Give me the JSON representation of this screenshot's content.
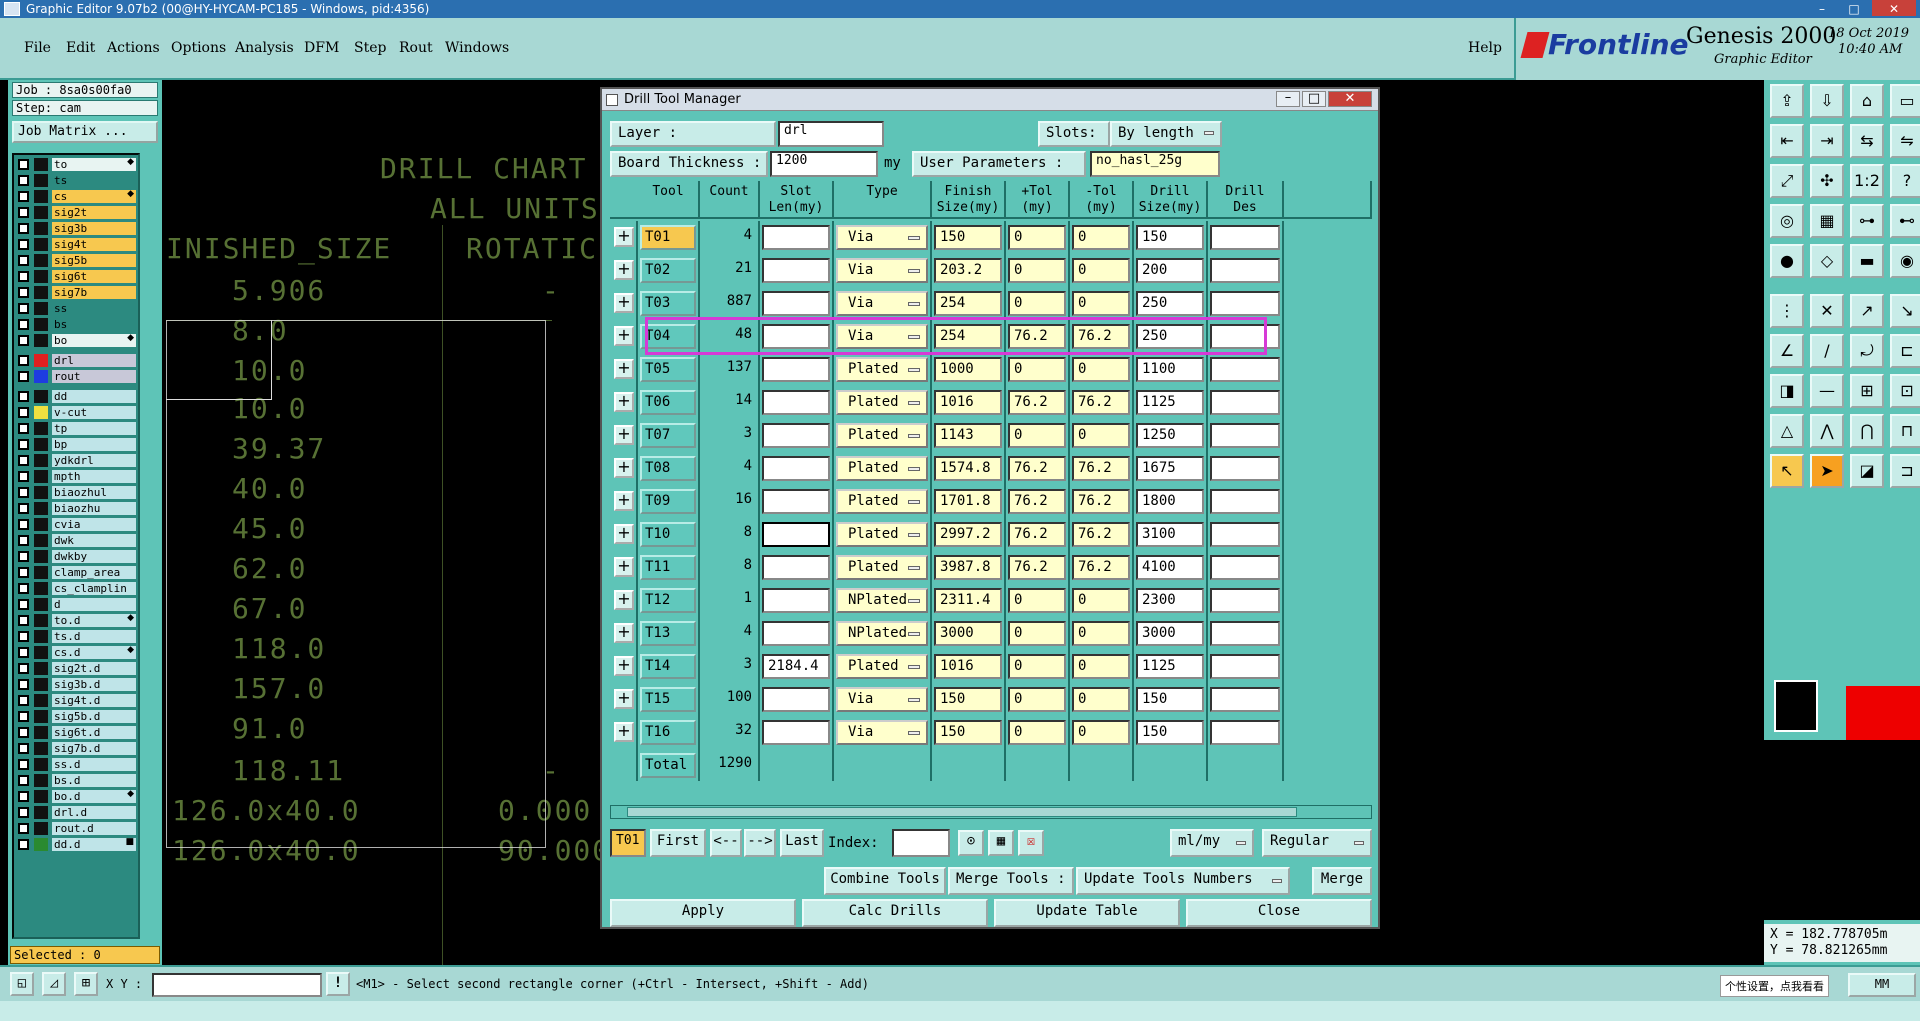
{
  "window_title": "Graphic Editor 9.07b2 (00@HY-HYCAM-PC185 - Windows, pid:4356)",
  "menu": [
    "File",
    "Edit",
    "Actions",
    "Options",
    "Analysis",
    "DFM",
    "Step",
    "Rout",
    "Windows"
  ],
  "help": "Help",
  "logo": {
    "brand": "Frontline",
    "product": "Genesis 2000",
    "subtitle": "Graphic Editor",
    "date": "18 Oct 2019",
    "time": "10:40 AM"
  },
  "job_info": {
    "job": "Job : 8sa0s00fa0",
    "step": "Step: cam",
    "matrix_button": "Job Matrix ..."
  },
  "layers": [
    {
      "name": "to",
      "color": "#e8f4f2",
      "sw": "#111",
      "arrow": "◆"
    },
    {
      "name": "ts",
      "color": "#2c8a80",
      "sw": "#111",
      "arrow": ""
    },
    {
      "name": "cs",
      "color": "#f7c84f",
      "sw": "#111",
      "arrow": "◆"
    },
    {
      "name": "sig2t",
      "color": "#f7c84f",
      "sw": "#111",
      "arrow": ""
    },
    {
      "name": "sig3b",
      "color": "#f7c84f",
      "sw": "#111",
      "arrow": ""
    },
    {
      "name": "sig4t",
      "color": "#f7c84f",
      "sw": "#111",
      "arrow": ""
    },
    {
      "name": "sig5b",
      "color": "#f7c84f",
      "sw": "#111",
      "arrow": ""
    },
    {
      "name": "sig6t",
      "color": "#f7c84f",
      "sw": "#111",
      "arrow": ""
    },
    {
      "name": "sig7b",
      "color": "#f7c84f",
      "sw": "#111",
      "arrow": ""
    },
    {
      "name": "ss",
      "color": "#2c8a80",
      "sw": "#111",
      "arrow": ""
    },
    {
      "name": "bs",
      "color": "#2c8a80",
      "sw": "#111",
      "arrow": ""
    },
    {
      "name": "bo",
      "color": "#e8f4f2",
      "sw": "#111",
      "arrow": "◆"
    },
    {
      "name": "drl",
      "color": "#c8c8d8",
      "sw": "#e02020",
      "arrow": ""
    },
    {
      "name": "rout",
      "color": "#c8c8d8",
      "sw": "#1e3ce0",
      "arrow": ""
    },
    {
      "name": "dd",
      "color": "#bfe4e8",
      "sw": "#111",
      "arrow": ""
    },
    {
      "name": "v-cut",
      "color": "#bfe4e8",
      "sw": "#f0e040",
      "arrow": ""
    },
    {
      "name": "tp",
      "color": "#bfe4e8",
      "sw": "#111",
      "arrow": ""
    },
    {
      "name": "bp",
      "color": "#bfe4e8",
      "sw": "#111",
      "arrow": ""
    },
    {
      "name": "ydkdrl",
      "color": "#bfe4e8",
      "sw": "#111",
      "arrow": ""
    },
    {
      "name": "mpth",
      "color": "#bfe4e8",
      "sw": "#111",
      "arrow": ""
    },
    {
      "name": "biaozhul",
      "color": "#bfe4e8",
      "sw": "#111",
      "arrow": ""
    },
    {
      "name": "biaozhu",
      "color": "#bfe4e8",
      "sw": "#111",
      "arrow": ""
    },
    {
      "name": "cvia",
      "color": "#bfe4e8",
      "sw": "#111",
      "arrow": ""
    },
    {
      "name": "dwk",
      "color": "#bfe4e8",
      "sw": "#111",
      "arrow": ""
    },
    {
      "name": "dwkby",
      "color": "#bfe4e8",
      "sw": "#111",
      "arrow": ""
    },
    {
      "name": "clamp_area",
      "color": "#bfe4e8",
      "sw": "#111",
      "arrow": ""
    },
    {
      "name": "cs_clamplin",
      "color": "#bfe4e8",
      "sw": "#111",
      "arrow": ""
    },
    {
      "name": "d",
      "color": "#bfe4e8",
      "sw": "#111",
      "arrow": ""
    },
    {
      "name": "to.d",
      "color": "#bfe4e8",
      "sw": "#111",
      "arrow": "◆"
    },
    {
      "name": "ts.d",
      "color": "#bfe4e8",
      "sw": "#111",
      "arrow": ""
    },
    {
      "name": "cs.d",
      "color": "#bfe4e8",
      "sw": "#111",
      "arrow": "◆"
    },
    {
      "name": "sig2t.d",
      "color": "#bfe4e8",
      "sw": "#111",
      "arrow": ""
    },
    {
      "name": "sig3b.d",
      "color": "#bfe4e8",
      "sw": "#111",
      "arrow": ""
    },
    {
      "name": "sig4t.d",
      "color": "#bfe4e8",
      "sw": "#111",
      "arrow": ""
    },
    {
      "name": "sig5b.d",
      "color": "#bfe4e8",
      "sw": "#111",
      "arrow": ""
    },
    {
      "name": "sig6t.d",
      "color": "#bfe4e8",
      "sw": "#111",
      "arrow": ""
    },
    {
      "name": "sig7b.d",
      "color": "#bfe4e8",
      "sw": "#111",
      "arrow": ""
    },
    {
      "name": "ss.d",
      "color": "#bfe4e8",
      "sw": "#111",
      "arrow": ""
    },
    {
      "name": "bs.d",
      "color": "#bfe4e8",
      "sw": "#111",
      "arrow": ""
    },
    {
      "name": "bo.d",
      "color": "#bfe4e8",
      "sw": "#111",
      "arrow": "◆"
    },
    {
      "name": "drl.d",
      "color": "#bfe4e8",
      "sw": "#111",
      "arrow": ""
    },
    {
      "name": "rout.d",
      "color": "#bfe4e8",
      "sw": "#111",
      "arrow": ""
    },
    {
      "name": "dd.d",
      "color": "#bfe4e8",
      "sw": "#2a8a30",
      "arrow": "■"
    }
  ],
  "selected": "Selected : 0",
  "drill_chart": {
    "title1": "DRILL CHART",
    "title2": "ALL UNITS",
    "col1": "INISHED_SIZE",
    "col2": "ROTATIC",
    "rows": [
      [
        "5.906",
        "-"
      ],
      [
        "8.0",
        ""
      ],
      [
        "10.0",
        ""
      ],
      [
        "10.0",
        ""
      ],
      [
        "39.37",
        ""
      ],
      [
        "40.0",
        ""
      ],
      [
        "45.0",
        ""
      ],
      [
        "62.0",
        ""
      ],
      [
        "67.0",
        ""
      ],
      [
        "118.0",
        ""
      ],
      [
        "157.0",
        ""
      ],
      [
        "91.0",
        ""
      ],
      [
        "118.11",
        "-"
      ],
      [
        "126.0x40.0",
        "0.000"
      ],
      [
        "126.0x40.0",
        "90.000"
      ]
    ]
  },
  "dialog": {
    "title": "Drill Tool Manager",
    "layer_label": "Layer         :",
    "layer_value": "drl",
    "slots_label": "Slots:",
    "slots_value": "By length",
    "thickness_label": "Board Thickness :",
    "thickness_value": "1200",
    "thickness_unit": "my",
    "userparams_label": "User Parameters :",
    "userparams_value": "no_hasl_25g",
    "headers": [
      "Tool",
      "Count",
      "Slot\nLen(my)",
      "Type",
      "Finish\nSize(my)",
      "+Tol\n(my)",
      "-Tol\n(my)",
      "Drill\nSize(my)",
      "Drill\nDes"
    ],
    "rows": [
      {
        "tool": "T01",
        "count": "4",
        "slot": "",
        "type": "Via",
        "finish": "150",
        "ptol": "0",
        "ntol": "0",
        "drill": "150",
        "des": ""
      },
      {
        "tool": "T02",
        "count": "21",
        "slot": "",
        "type": "Via",
        "finish": "203.2",
        "ptol": "0",
        "ntol": "0",
        "drill": "200",
        "des": ""
      },
      {
        "tool": "T03",
        "count": "887",
        "slot": "",
        "type": "Via",
        "finish": "254",
        "ptol": "0",
        "ntol": "0",
        "drill": "250",
        "des": ""
      },
      {
        "tool": "T04",
        "count": "48",
        "slot": "",
        "type": "Via",
        "finish": "254",
        "ptol": "76.2",
        "ntol": "76.2",
        "drill": "250",
        "des": ""
      },
      {
        "tool": "T05",
        "count": "137",
        "slot": "",
        "type": "Plated",
        "finish": "1000",
        "ptol": "0",
        "ntol": "0",
        "drill": "1100",
        "des": ""
      },
      {
        "tool": "T06",
        "count": "14",
        "slot": "",
        "type": "Plated",
        "finish": "1016",
        "ptol": "76.2",
        "ntol": "76.2",
        "drill": "1125",
        "des": ""
      },
      {
        "tool": "T07",
        "count": "3",
        "slot": "",
        "type": "Plated",
        "finish": "1143",
        "ptol": "0",
        "ntol": "0",
        "drill": "1250",
        "des": ""
      },
      {
        "tool": "T08",
        "count": "4",
        "slot": "",
        "type": "Plated",
        "finish": "1574.8",
        "ptol": "76.2",
        "ntol": "76.2",
        "drill": "1675",
        "des": ""
      },
      {
        "tool": "T09",
        "count": "16",
        "slot": "",
        "type": "Plated",
        "finish": "1701.8",
        "ptol": "76.2",
        "ntol": "76.2",
        "drill": "1800",
        "des": ""
      },
      {
        "tool": "T10",
        "count": "8",
        "slot": "",
        "type": "Plated",
        "finish": "2997.2",
        "ptol": "76.2",
        "ntol": "76.2",
        "drill": "3100",
        "des": ""
      },
      {
        "tool": "T11",
        "count": "8",
        "slot": "",
        "type": "Plated",
        "finish": "3987.8",
        "ptol": "76.2",
        "ntol": "76.2",
        "drill": "4100",
        "des": ""
      },
      {
        "tool": "T12",
        "count": "1",
        "slot": "",
        "type": "NPlated",
        "finish": "2311.4",
        "ptol": "0",
        "ntol": "0",
        "drill": "2300",
        "des": ""
      },
      {
        "tool": "T13",
        "count": "4",
        "slot": "",
        "type": "NPlated",
        "finish": "3000",
        "ptol": "0",
        "ntol": "0",
        "drill": "3000",
        "des": ""
      },
      {
        "tool": "T14",
        "count": "3",
        "slot": "2184.4",
        "type": "Plated",
        "finish": "1016",
        "ptol": "0",
        "ntol": "0",
        "drill": "1125",
        "des": ""
      },
      {
        "tool": "T15",
        "count": "100",
        "slot": "",
        "type": "Via",
        "finish": "150",
        "ptol": "0",
        "ntol": "0",
        "drill": "150",
        "des": ""
      },
      {
        "tool": "T16",
        "count": "32",
        "slot": "",
        "type": "Via",
        "finish": "150",
        "ptol": "0",
        "ntol": "0",
        "drill": "150",
        "des": ""
      }
    ],
    "total_label": "Total",
    "total_value": "1290",
    "nav": {
      "current": "T01",
      "first": "First",
      "prev": "<--",
      "next": "-->",
      "last": "Last",
      "index_label": "Index:",
      "units": "ml/my",
      "mode": "Regular"
    },
    "combine": "Combine Tools",
    "merge_label": "Merge Tools :",
    "update_numbers": "Update Tools Numbers",
    "merge": "Merge",
    "apply": "Apply",
    "calc": "Calc Drills",
    "update_table": "Update Table",
    "close": "Close"
  },
  "coords": {
    "x": "X = 182.778705m",
    "y": "Y = 78.821265mm"
  },
  "status": {
    "xy_label": "X Y :",
    "message": "<M1> - Select second rectangle corner (+Ctrl - Intersect, +Shift - Add)",
    "units": "MM",
    "tooltip": "个性设置，点我看看"
  }
}
